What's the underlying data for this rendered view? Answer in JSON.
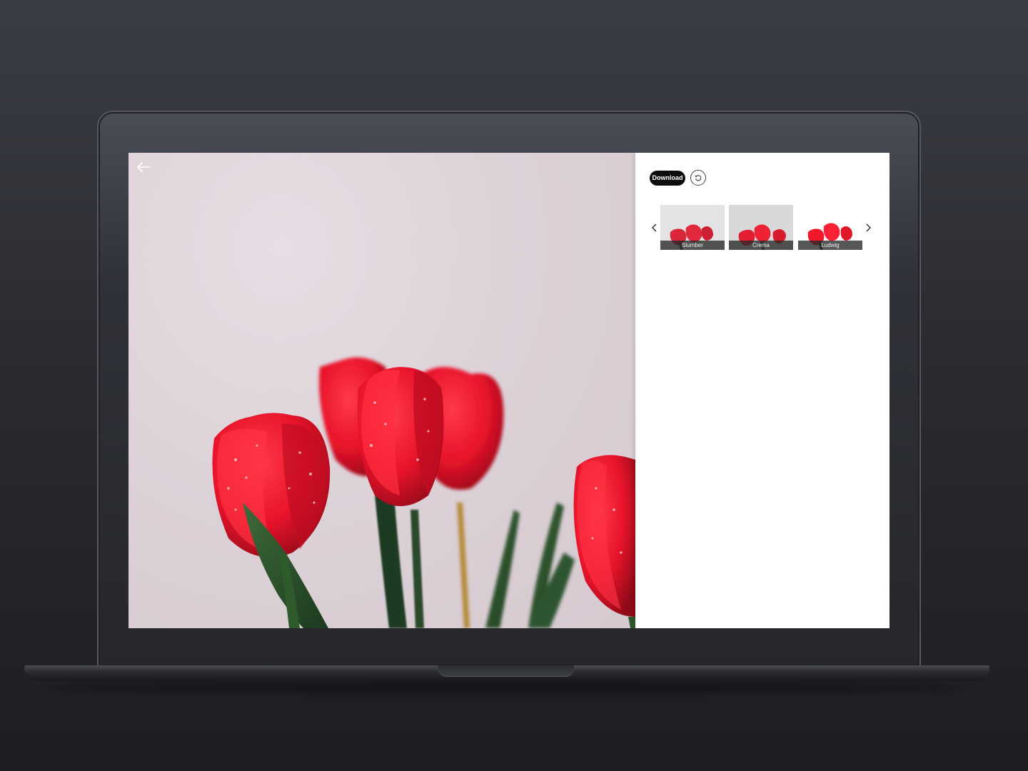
{
  "viewer": {
    "back_icon": "arrow-left-icon",
    "photo_subject": "red tulips with water droplets"
  },
  "panel": {
    "download_label": "Download",
    "reset_icon": "rotate-ccw-icon",
    "prev_icon": "chevron-left-icon",
    "next_icon": "chevron-right-icon",
    "filters": [
      {
        "label": "Slumber"
      },
      {
        "label": "Crema"
      },
      {
        "label": "Ludwig"
      }
    ]
  },
  "colors": {
    "accent": "#0c0c0c",
    "tulip_red": "#e8132a",
    "photo_background": "#ddd2d8"
  }
}
